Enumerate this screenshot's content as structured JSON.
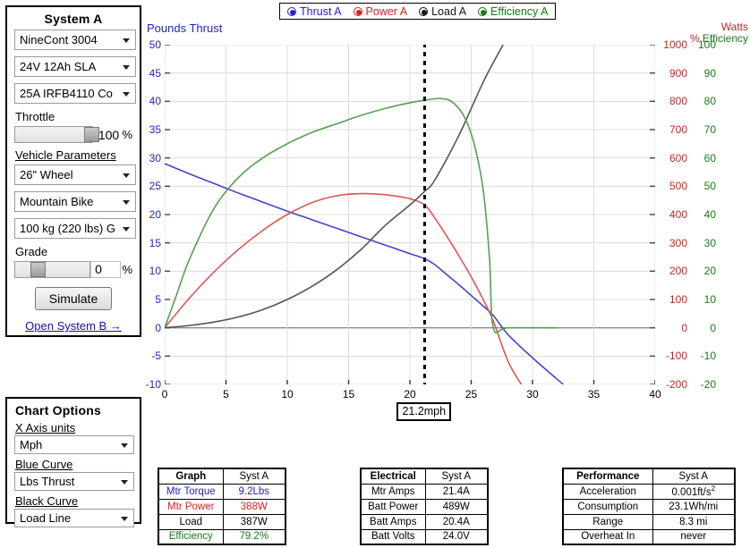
{
  "system_panel": {
    "title": "System A",
    "motor": "NineCont 3004",
    "battery": "24V 12Ah SLA",
    "controller": "25A IRFB4110 Co",
    "throttle_label": "Throttle",
    "throttle_value": "100",
    "throttle_unit": "%",
    "throttle_percent": 100,
    "vehicle_label": "Vehicle Parameters",
    "wheel": "26\" Wheel",
    "bike": "Mountain Bike",
    "weight": "100 kg (220 lbs) G",
    "grade_label": "Grade",
    "grade_value": "0",
    "grade_unit": "%",
    "grade_percent": 22,
    "simulate_label": "Simulate",
    "open_b_label": "Open System B →"
  },
  "chart_options": {
    "title": "Chart Options",
    "x_axis_label": "X Axis units",
    "x_axis_value": "Mph",
    "blue_curve_label": "Blue Curve",
    "blue_curve_value": "Lbs Thrust",
    "black_curve_label": "Black Curve",
    "black_curve_value": "Load Line"
  },
  "legend": [
    {
      "label": "Thrust A",
      "color": "#2222cc"
    },
    {
      "label": "Power A",
      "color": "#dd2222"
    },
    {
      "label": "Load A",
      "color": "#111111"
    },
    {
      "label": "Efficiency A",
      "color": "#177a17"
    }
  ],
  "cursor": {
    "label": "21.2mph",
    "x_value": 21.2
  },
  "chart_data": {
    "type": "line",
    "title": "",
    "xlabel": "Mph",
    "axis_titles": {
      "left": "Pounds Thrust",
      "right_watts": "Watts",
      "right_eff_pct": "%",
      "right_eff": "Efficiency"
    },
    "xlim": [
      0,
      40
    ],
    "xticks": [
      0,
      5,
      10,
      15,
      20,
      25,
      30,
      35,
      40
    ],
    "ylim_left": [
      -10,
      50
    ],
    "yticks_left": [
      50,
      45,
      40,
      35,
      30,
      25,
      20,
      15,
      10,
      5,
      0,
      -5,
      -10
    ],
    "ylim_watts": [
      -200,
      1000
    ],
    "yticks_watts": [
      1000,
      900,
      800,
      700,
      600,
      500,
      400,
      300,
      200,
      100,
      0,
      -100,
      -200
    ],
    "ylim_eff": [
      -20,
      100
    ],
    "yticks_eff": [
      100,
      90,
      80,
      70,
      60,
      50,
      40,
      30,
      20,
      10,
      0,
      -10,
      -20
    ],
    "grid": true,
    "legend_position": "top",
    "series": [
      {
        "name": "Thrust A",
        "color": "#4444cc",
        "axis": "left",
        "units": "Lbs Thrust",
        "x": [
          0,
          2,
          4,
          6,
          8,
          10,
          12,
          14,
          16,
          18,
          20,
          21.2,
          22,
          23,
          24,
          25,
          26,
          26.8,
          28,
          30,
          32.5
        ],
        "y": [
          29.0,
          27.2,
          25.5,
          23.8,
          22.2,
          20.6,
          19.1,
          17.6,
          16.1,
          14.6,
          13.1,
          12.2,
          11.2,
          9.4,
          7.6,
          5.7,
          3.8,
          2.2,
          -1.2,
          -5.3,
          -10.0
        ]
      },
      {
        "name": "Power A",
        "color": "#e05555",
        "axis": "watts",
        "units": "Watts",
        "x": [
          0,
          2,
          4,
          6,
          8,
          10,
          12,
          14,
          16,
          18,
          20,
          21.2,
          22,
          23,
          24,
          25,
          26,
          26.8,
          28,
          29.2
        ],
        "y": [
          0,
          104,
          196,
          276,
          344,
          400,
          442,
          466,
          474,
          470,
          456,
          434,
          390,
          324,
          254,
          180,
          98,
          24,
          -118,
          -208
        ]
      },
      {
        "name": "Load A",
        "color": "#555555",
        "axis": "watts",
        "units": "Watts",
        "x": [
          0,
          2,
          4,
          6,
          8,
          10,
          12,
          14,
          16,
          18,
          20,
          21.2,
          22,
          24,
          26,
          27.6
        ],
        "y": [
          0,
          8,
          20,
          38,
          64,
          100,
          146,
          204,
          276,
          362,
          434,
          482,
          520,
          680,
          870,
          1000
        ]
      },
      {
        "name": "Efficiency A",
        "color": "#55a055",
        "axis": "eff",
        "units": "% Efficiency",
        "x": [
          0,
          1,
          2,
          4,
          6,
          8,
          10,
          12,
          14,
          16,
          18,
          20,
          21.2,
          22.5,
          23.5,
          24.5,
          25.3,
          26,
          26.5,
          26.8,
          28,
          32,
          36,
          40
        ],
        "y": [
          0,
          12,
          24,
          42,
          53,
          60,
          65,
          69,
          72,
          75,
          77.5,
          79.5,
          80.4,
          81.0,
          79.6,
          74.0,
          64.0,
          48.0,
          24.0,
          0,
          0,
          0,
          0
        ]
      }
    ]
  },
  "tables": {
    "graph": {
      "header": [
        "Graph",
        "Syst A"
      ],
      "rows": [
        {
          "label": "Mtr Torque",
          "value": "9.2Lbs",
          "color": "#2222cc"
        },
        {
          "label": "Mtr Power",
          "value": "388W",
          "color": "#dd2222"
        },
        {
          "label": "Load",
          "value": "387W",
          "color": "#000000"
        },
        {
          "label": "Efficiency",
          "value": "79.2%",
          "color": "#177a17"
        }
      ]
    },
    "electrical": {
      "header": [
        "Electrical",
        "Syst A"
      ],
      "rows": [
        {
          "label": "Mtr Amps",
          "value": "21.4A"
        },
        {
          "label": "Batt Power",
          "value": "489W"
        },
        {
          "label": "Batt Amps",
          "value": "20.4A"
        },
        {
          "label": "Batt Volts",
          "value": "24.0V"
        }
      ]
    },
    "performance": {
      "header": [
        "Performance",
        "Syst A"
      ],
      "rows": [
        {
          "label": "Acceleration",
          "value": "0.001ft/s",
          "sup": "2"
        },
        {
          "label": "Consumption",
          "value": "23.1Wh/mi"
        },
        {
          "label": "Range",
          "value": "8.3 mi"
        },
        {
          "label": "Overheat In",
          "value": "never"
        }
      ]
    }
  }
}
